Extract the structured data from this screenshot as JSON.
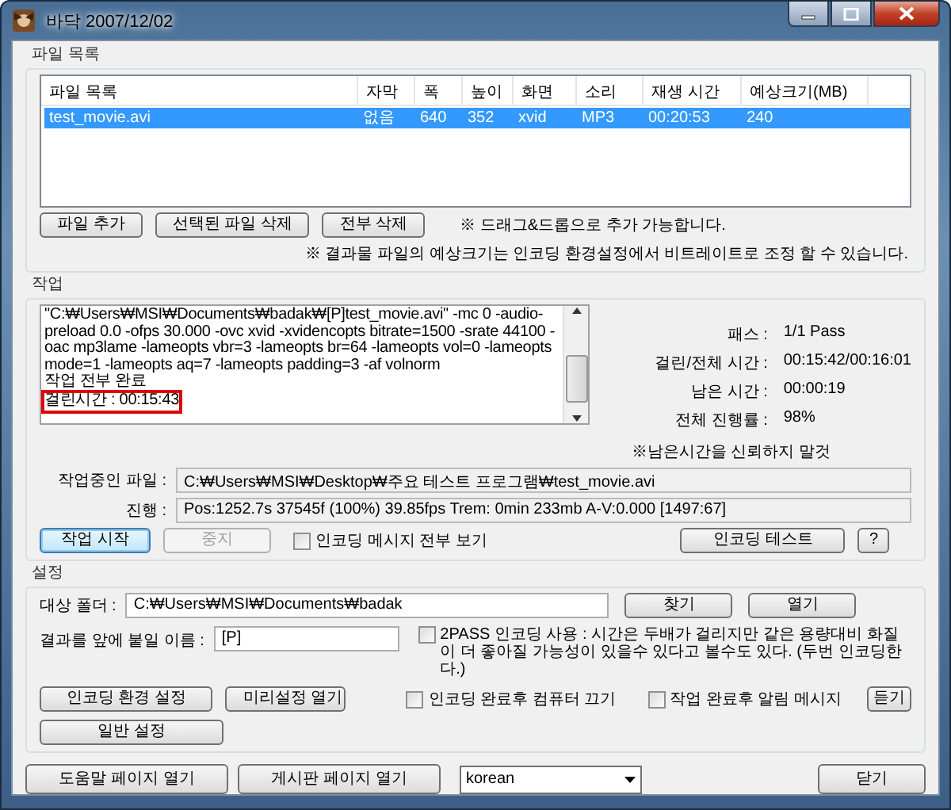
{
  "window": {
    "title": "바닥 2007/12/02"
  },
  "file_list": {
    "group_label": "파일 목록",
    "columns": [
      "파일 목록",
      "자막",
      "폭",
      "높이",
      "화면",
      "소리",
      "재생 시간",
      "예상크기(MB)"
    ],
    "rows": [
      {
        "cells": [
          "test_movie.avi",
          "없음",
          "640",
          "352",
          "xvid",
          "MP3",
          "00:20:53",
          "240"
        ],
        "selected": true
      }
    ],
    "buttons": [
      "파일 추가",
      "선택된 파일 삭제",
      "전부 삭제"
    ],
    "notes": [
      "※ 드래그&드롭으로 추가 가능합니다.",
      "※ 결과물 파일의 예상크기는 인코딩 환경설정에서 비트레이트로 조정 할 수 있습니다."
    ]
  },
  "job": {
    "group_label": "작업",
    "log_lines": [
      {
        "text": "\"C:₩Users₩MSI₩Documents₩badak₩[P]test_movie.avi\" -mc 0 -audio-",
        "highlighted": false
      },
      {
        "text": "preload 0.0 -ofps 30.000 -ovc xvid -xvidencopts bitrate=1500 -srate 44100 -",
        "highlighted": false
      },
      {
        "text": "oac mp3lame -lameopts vbr=3  -lameopts br=64 -lameopts vol=0 -lameopts",
        "highlighted": false
      },
      {
        "text": "mode=1 -lameopts aq=7 -lameopts padding=3 -af volnorm",
        "highlighted": false
      },
      {
        "text": "작업 전부 완료",
        "highlighted": false
      },
      {
        "text": "걸린시간 : 00:15:43",
        "highlighted": true
      }
    ],
    "stats": [
      {
        "label": "패스 :",
        "value": "1/1 Pass"
      },
      {
        "label": "걸린/전체 시간 :",
        "value": "00:15:42/00:16:01"
      },
      {
        "label": "남은 시간 :",
        "value": "00:00:19"
      },
      {
        "label": "전체 진행률 :",
        "value": "98%"
      }
    ],
    "warning": "※남은시간을 신뢰하지 말것",
    "current_file": {
      "label": "작업중인 파일 :",
      "value": "C:₩Users₩MSI₩Desktop₩주요 테스트 프로그램₩test_movie.avi"
    },
    "progress": {
      "label": "진행 :",
      "value": "Pos:1252.7s  37545f (100%) 39.85fps Trem:   0min 233mb  A-V:0.000 [1497:67]"
    },
    "start_button": {
      "label": "작업 시작",
      "default": true,
      "disabled": false
    },
    "stop_button": {
      "label": "중지",
      "default": false,
      "disabled": true
    },
    "show_all_messages": {
      "label": "인코딩 메시지 전부 보기",
      "checked": false
    },
    "test_button": "인코딩 테스트",
    "help_button": "?"
  },
  "settings": {
    "group_label": "설정",
    "target_folder": {
      "label": "대상 폴더 :",
      "value": "C:₩Users₩MSI₩Documents₩badak"
    },
    "find_button": "찾기",
    "open_button": "열기",
    "prefix": {
      "label": "결과를 앞에 붙일 이름 :",
      "value": "[P]"
    },
    "two_pass": {
      "label": "2PASS 인코딩 사용 : 시간은 두배가 걸리지만 같은 용량대비 화질이 더 좋아질 가능성이 있을수 있다고 볼수도 있다. (두번 인코딩한다.)",
      "checked": false
    },
    "encoding_settings_button": "인코딩 환경 설정",
    "preset_button": "미리설정 열기",
    "general_settings_button": "일반 설정",
    "shutdown": {
      "label": "인코딩 완료후 컴퓨터 끄기",
      "checked": false
    },
    "notify": {
      "label": "작업 완료후 알림 메시지",
      "checked": false
    },
    "listen_button": "듣기"
  },
  "footer": {
    "help_page_button": "도움말 페이지 열기",
    "board_page_button": "게시판 페이지 열기",
    "language": "korean",
    "close_button": "닫기"
  }
}
